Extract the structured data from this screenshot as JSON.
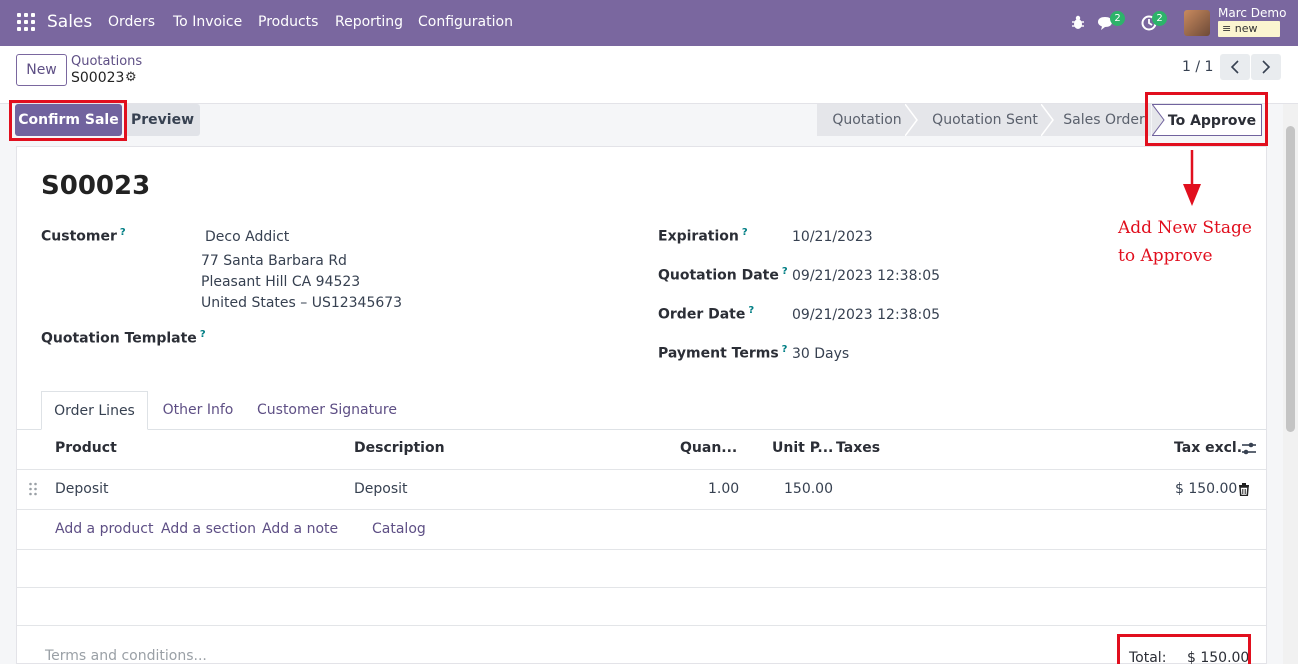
{
  "navbar": {
    "brand": "Sales",
    "menu": [
      "Orders",
      "To Invoice",
      "Products",
      "Reporting",
      "Configuration"
    ],
    "messages_count": "2",
    "activities_count": "2",
    "user_name": "Marc Demo",
    "database": "new"
  },
  "control": {
    "new_label": "New",
    "breadcrumb_parent": "Quotations",
    "breadcrumb_current": "S00023",
    "pager": "1 / 1"
  },
  "actions": {
    "confirm_label": "Confirm Sale",
    "preview_label": "Preview"
  },
  "stages": [
    "Quotation",
    "Quotation Sent",
    "Sales Order",
    "To Approve"
  ],
  "active_stage": "To Approve",
  "annotation": {
    "line1": "Add New Stage",
    "line2": "to Approve"
  },
  "form": {
    "title": "S00023",
    "customer_label": "Customer",
    "customer_name": "Deco Addict",
    "customer_street": "77 Santa Barbara Rd",
    "customer_city": "Pleasant Hill CA 94523",
    "customer_country": "United States – US12345673",
    "template_label": "Quotation Template",
    "expiration_label": "Expiration",
    "expiration_value": "10/21/2023",
    "quotation_date_label": "Quotation Date",
    "quotation_date_value": "09/21/2023 12:38:05",
    "order_date_label": "Order Date",
    "order_date_value": "09/21/2023 12:38:05",
    "payment_terms_label": "Payment Terms",
    "payment_terms_value": "30 Days"
  },
  "tabs": [
    "Order Lines",
    "Other Info",
    "Customer Signature"
  ],
  "table": {
    "headers": {
      "product": "Product",
      "description": "Description",
      "quantity": "Quan...",
      "unit_price": "Unit P...",
      "taxes": "Taxes",
      "tax_excl": "Tax excl."
    },
    "rows": [
      {
        "product": "Deposit",
        "description": "Deposit",
        "quantity": "1.00",
        "unit_price": "150.00",
        "taxes": "",
        "subtotal": "$ 150.00"
      }
    ],
    "add_product": "Add a product",
    "add_section": "Add a section",
    "add_note": "Add a note",
    "catalog": "Catalog"
  },
  "footer": {
    "terms_placeholder": "Terms and conditions...",
    "total_label": "Total:",
    "total_value": "$ 150.00"
  },
  "colors": {
    "brand": "#7a679f",
    "primary_button": "#71639e",
    "annotation": "#e10f1e"
  }
}
